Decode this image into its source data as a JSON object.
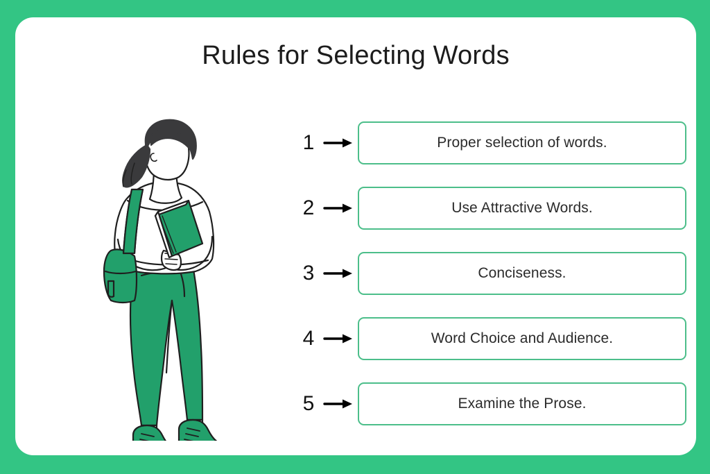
{
  "theme": {
    "frame_green": "#33c584",
    "box_border_green": "#4cbe8a",
    "card_background": "#ffffff",
    "title_color": "#1c1c1c",
    "text_color": "#2b2b2b",
    "number_color": "#111111",
    "arrow_color": "#000000",
    "illustration_green": "#22a06b",
    "illustration_hair": "#3a3a3c",
    "illustration_outline": "#1f1f1f"
  },
  "header": {
    "title": "Rules for Selecting Words"
  },
  "illustration": {
    "alt": "Line-art illustration of a student standing, wearing a white off-shoulder top and green pants, carrying a green backpack and holding green books"
  },
  "rules": [
    {
      "number": "1",
      "arrow": "→",
      "text": "Proper selection of words."
    },
    {
      "number": "2",
      "arrow": "→",
      "text": "Use Attractive Words."
    },
    {
      "number": "3",
      "arrow": "→",
      "text": "Conciseness."
    },
    {
      "number": "4",
      "arrow": "→",
      "text": "Word Choice and Audience."
    },
    {
      "number": "5",
      "arrow": "→",
      "text": "Examine the Prose."
    }
  ]
}
